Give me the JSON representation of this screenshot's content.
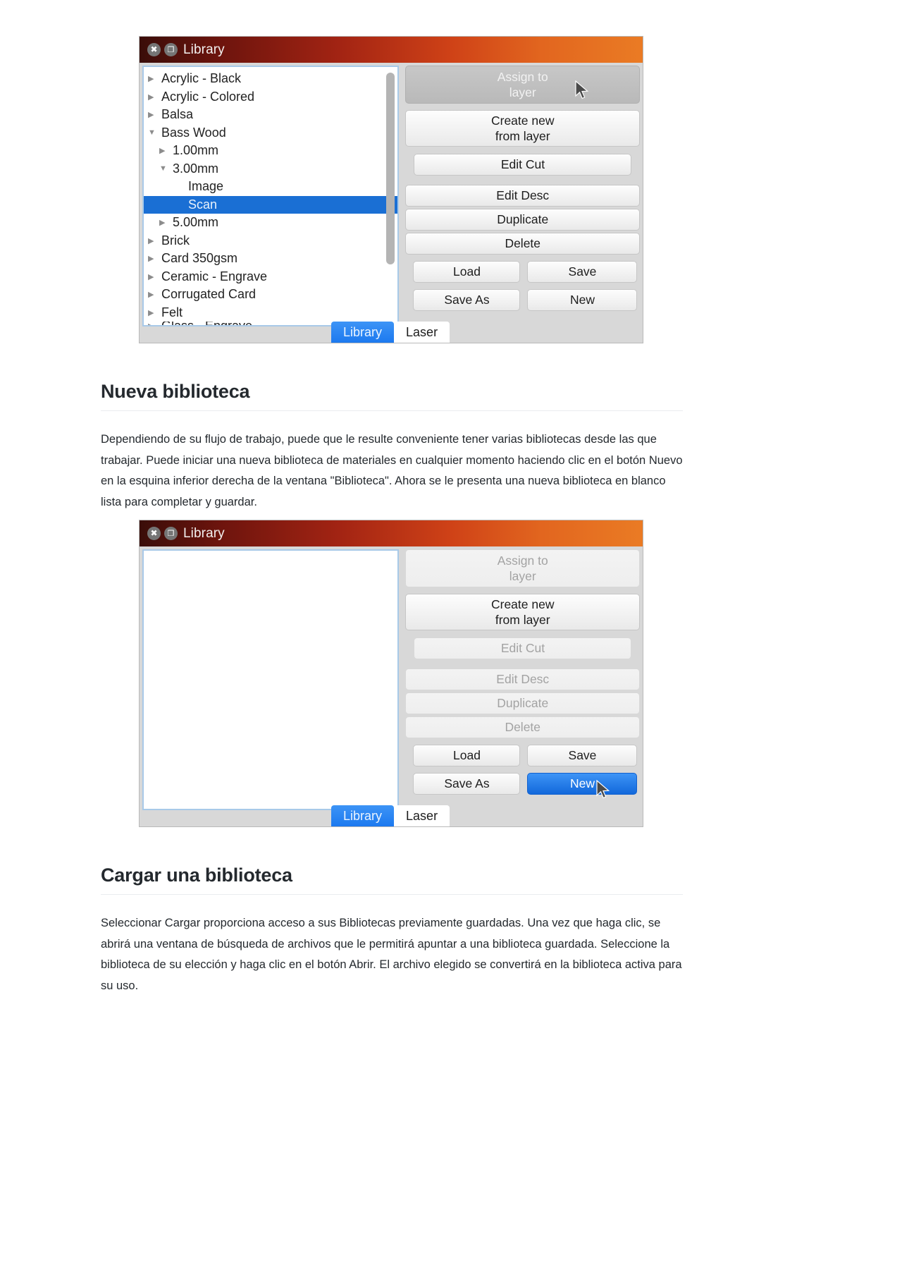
{
  "document": {
    "sections": [
      {
        "heading": "Nueva biblioteca",
        "paragraph": "Dependiendo de su flujo de trabajo, puede que le resulte conveniente tener varias bibliotecas desde las que trabajar. Puede iniciar una nueva biblioteca de materiales en cualquier momento haciendo clic en el botón Nuevo en la esquina inferior derecha de la ventana \"Biblioteca\". Ahora se le presenta una nueva biblioteca en blanco lista para completar y guardar."
      },
      {
        "heading": "Cargar una biblioteca",
        "paragraph": "Seleccionar Cargar proporciona acceso a sus Bibliotecas previamente guardadas. Una vez que haga clic, se abrirá una ventana de búsqueda de archivos que le permitirá apuntar a una biblioteca guardada. Seleccione la biblioteca de su elección y haga clic en el botón Abrir. El archivo elegido se convertirá en la biblioteca activa para su uso."
      }
    ]
  },
  "dialog_one": {
    "title": "Library",
    "close_icon": "close-icon",
    "restore_icon": "restore-window-icon",
    "tree": [
      {
        "label": "Acrylic - Black",
        "level": 1,
        "twisty": "collapsed",
        "selected": false
      },
      {
        "label": "Acrylic - Colored",
        "level": 1,
        "twisty": "collapsed",
        "selected": false
      },
      {
        "label": "Balsa",
        "level": 1,
        "twisty": "collapsed",
        "selected": false
      },
      {
        "label": "Bass Wood",
        "level": 1,
        "twisty": "expanded",
        "selected": false
      },
      {
        "label": "1.00mm",
        "level": 2,
        "twisty": "collapsed",
        "selected": false
      },
      {
        "label": "3.00mm",
        "level": 2,
        "twisty": "expanded",
        "selected": false
      },
      {
        "label": "Image",
        "level": 3,
        "twisty": "none",
        "selected": false
      },
      {
        "label": "Scan",
        "level": 3,
        "twisty": "none",
        "selected": true
      },
      {
        "label": "5.00mm",
        "level": 2,
        "twisty": "collapsed",
        "selected": false
      },
      {
        "label": "Brick",
        "level": 1,
        "twisty": "collapsed",
        "selected": false
      },
      {
        "label": "Card 350gsm",
        "level": 1,
        "twisty": "collapsed",
        "selected": false
      },
      {
        "label": "Ceramic - Engrave",
        "level": 1,
        "twisty": "collapsed",
        "selected": false
      },
      {
        "label": "Corrugated Card",
        "level": 1,
        "twisty": "collapsed",
        "selected": false
      },
      {
        "label": "Felt",
        "level": 1,
        "twisty": "collapsed",
        "selected": false
      },
      {
        "label": "Glass - Engrave",
        "level": 1,
        "twisty": "collapsed",
        "selected": false
      }
    ],
    "buttons": {
      "assign_to_layer": "Assign to\nlayer",
      "create_new_from_layer": "Create new\nfrom layer",
      "edit_cut": "Edit Cut",
      "edit_desc": "Edit Desc",
      "duplicate": "Duplicate",
      "delete": "Delete",
      "load": "Load",
      "save": "Save",
      "save_as": "Save As",
      "new": "New"
    },
    "tabs": {
      "library": "Library",
      "laser": "Laser"
    },
    "cursor": "mouse-pointer"
  },
  "dialog_two": {
    "title": "Library",
    "close_icon": "close-icon",
    "restore_icon": "restore-window-icon",
    "tree": [],
    "buttons": {
      "assign_to_layer": "Assign to\nlayer",
      "create_new_from_layer": "Create new\nfrom layer",
      "edit_cut": "Edit Cut",
      "edit_desc": "Edit Desc",
      "duplicate": "Duplicate",
      "delete": "Delete",
      "load": "Load",
      "save": "Save",
      "save_as": "Save As",
      "new": "New"
    },
    "tabs": {
      "library": "Library",
      "laser": "Laser"
    },
    "cursor": "mouse-pointer"
  },
  "colors": {
    "selection_blue": "#1a6fd4",
    "primary_button": "#1268db",
    "title_gradient_start": "#3a0d09",
    "title_gradient_end": "#ea7b24",
    "panel_border": "#a8c9e8"
  }
}
